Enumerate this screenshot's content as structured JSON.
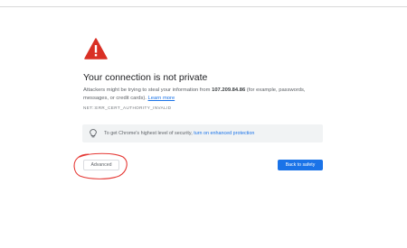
{
  "interstitial": {
    "title": "Your connection is not private",
    "description_prefix": "Attackers might be trying to steal your information from ",
    "host": "107.209.84.86",
    "description_suffix": " (for example, passwords, messages, or credit cards). ",
    "learn_more": "Learn more",
    "error_code": "NET::ERR_CERT_AUTHORITY_INVALID",
    "icon": "warning-triangle-icon",
    "icon_color": "#d93025"
  },
  "protection_box": {
    "text": "To get Chrome's highest level of security, ",
    "link": "turn on enhanced protection",
    "icon": "lightbulb-icon"
  },
  "buttons": {
    "advanced_label": "Advanced",
    "back_label": "Back to safety",
    "back_color": "#1a73e8"
  },
  "annotation": {
    "type": "hand-drawn-circle",
    "color": "#e53935"
  }
}
